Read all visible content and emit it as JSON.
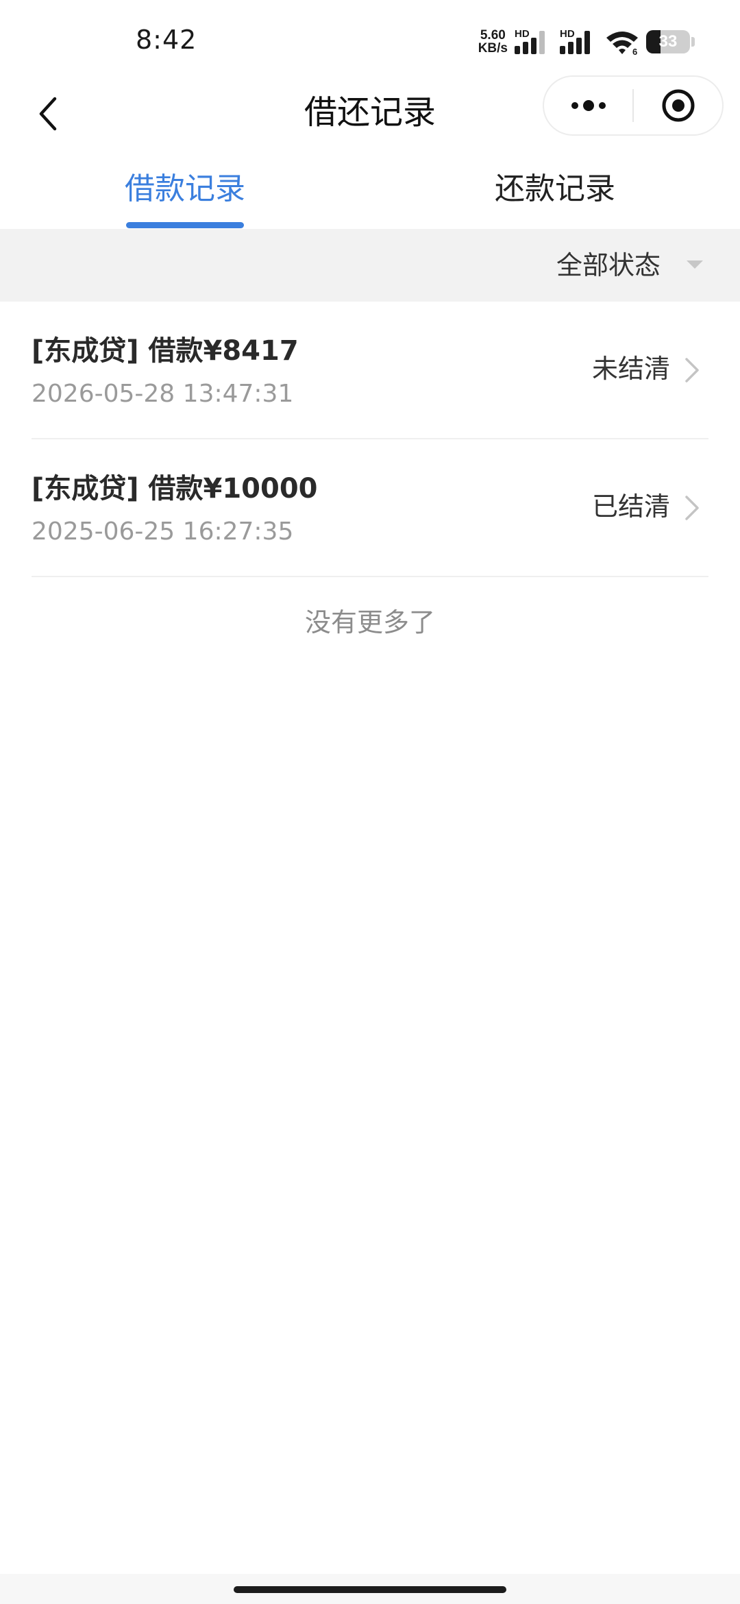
{
  "status_bar": {
    "time": "8:42",
    "net_speed_value": "5.60",
    "net_speed_unit": "KB/s",
    "sim1_label": "HD",
    "sim2_label": "HD",
    "wifi_label": "6",
    "battery_level": "33",
    "battery_fraction": 0.33
  },
  "nav": {
    "title": "借还记录"
  },
  "tabs": [
    {
      "label": "借款记录",
      "active": true
    },
    {
      "label": "还款记录",
      "active": false
    }
  ],
  "filter": {
    "label": "全部状态"
  },
  "records": [
    {
      "title": "[东成贷] 借款¥8417",
      "time": "2026-05-28 13:47:31",
      "status": "未结清"
    },
    {
      "title": "[东成贷] 借款¥10000",
      "time": "2025-06-25 16:27:35",
      "status": "已结清"
    }
  ],
  "list_footer": "没有更多了",
  "colors": {
    "accent": "#3b7fde",
    "filter_bg": "#f2f2f2",
    "muted_text": "#9a9a9a"
  }
}
